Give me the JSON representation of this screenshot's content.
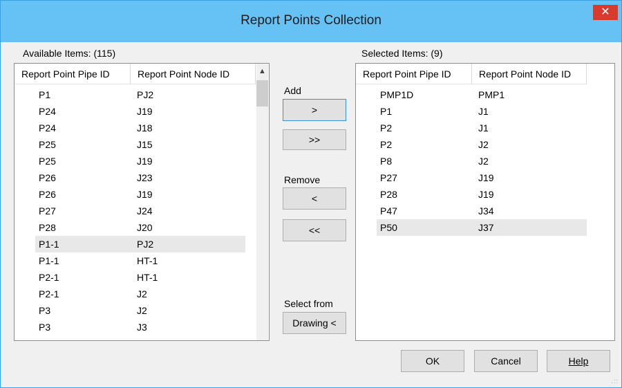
{
  "dialog": {
    "title": "Report Points Collection",
    "close_glyph": "✕"
  },
  "available": {
    "label": "Available Items:  (115)",
    "columns": [
      "Report Point Pipe ID",
      "Report Point Node ID"
    ],
    "rows": [
      [
        "P1",
        "PJ2"
      ],
      [
        "P24",
        "J19"
      ],
      [
        "P24",
        "J18"
      ],
      [
        "P25",
        "J15"
      ],
      [
        "P25",
        "J19"
      ],
      [
        "P26",
        "J23"
      ],
      [
        "P26",
        "J19"
      ],
      [
        "P27",
        "J24"
      ],
      [
        "P28",
        "J20"
      ],
      [
        "P1-1",
        "PJ2"
      ],
      [
        "P1-1",
        "HT-1"
      ],
      [
        "P2-1",
        "HT-1"
      ],
      [
        "P2-1",
        "J2"
      ],
      [
        "P3",
        "J2"
      ],
      [
        "P3",
        "J3"
      ]
    ],
    "selected_row_index": 9
  },
  "selected": {
    "label": "Selected Items:  (9)",
    "columns": [
      "Report Point Pipe ID",
      "Report Point Node ID"
    ],
    "rows": [
      [
        "PMP1D",
        "PMP1"
      ],
      [
        "P1",
        "J1"
      ],
      [
        "P2",
        "J1"
      ],
      [
        "P2",
        "J2"
      ],
      [
        "P8",
        "J2"
      ],
      [
        "P27",
        "J19"
      ],
      [
        "P28",
        "J19"
      ],
      [
        "P47",
        "J34"
      ],
      [
        "P50",
        "J37"
      ]
    ],
    "selected_row_index": 8
  },
  "controls": {
    "add_label": "Add",
    "add_one": ">",
    "add_all": ">>",
    "remove_label": "Remove",
    "remove_one": "<",
    "remove_all": "<<",
    "select_from_label": "Select from",
    "drawing_button": "Drawing <",
    "scroll_up": "▲",
    "scroll_down": "▼"
  },
  "footer": {
    "ok": "OK",
    "cancel": "Cancel",
    "help": "Help"
  }
}
